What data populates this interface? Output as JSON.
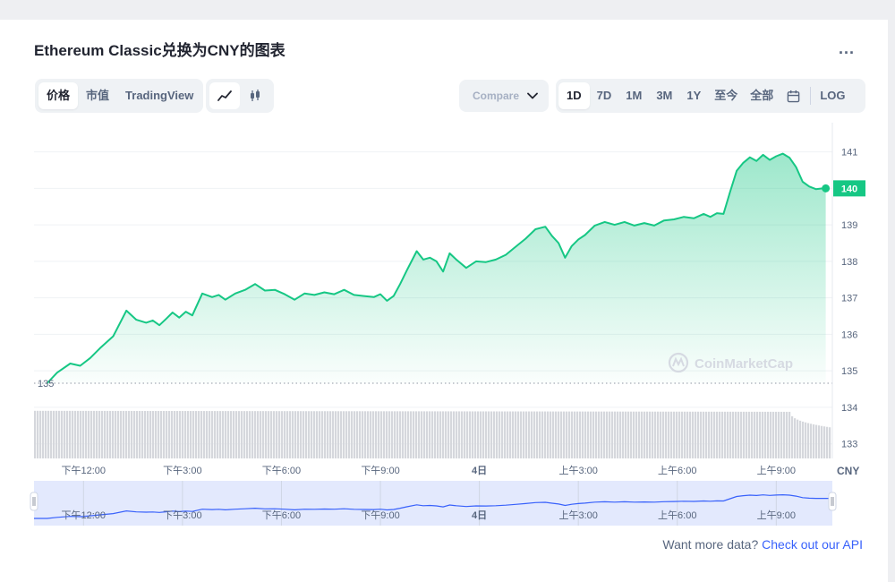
{
  "header": {
    "title": "Ethereum Classic兑换为CNY的图表",
    "more_label": "..."
  },
  "tabs": {
    "items": [
      {
        "label": "价格",
        "active": true
      },
      {
        "label": "市值",
        "active": false
      },
      {
        "label": "TradingView",
        "active": false
      }
    ]
  },
  "chart_type_toggle": [
    {
      "icon": "line-chart-icon",
      "active": true
    },
    {
      "icon": "candlestick-icon",
      "active": false
    }
  ],
  "compare": {
    "placeholder": "Compare with"
  },
  "ranges": {
    "items": [
      {
        "label": "1D",
        "active": true
      },
      {
        "label": "7D",
        "active": false
      },
      {
        "label": "1M",
        "active": false
      },
      {
        "label": "3M",
        "active": false
      },
      {
        "label": "1Y",
        "active": false
      },
      {
        "label": "至今",
        "active": false
      },
      {
        "label": "全部",
        "active": false
      }
    ],
    "calendar_icon": "calendar-icon",
    "log_label": "LOG"
  },
  "footer": {
    "prompt": "Want more data?",
    "link": "Check out our API"
  },
  "colors": {
    "line": "#16c784",
    "navigator_line": "#3861fb",
    "navigator_fill": "#e3e9fd",
    "volume": "#d5d7dc",
    "grid": "#eff2f5",
    "axis_text": "#58667e",
    "current_price_bg": "#16c784"
  },
  "chart_data": {
    "type": "area",
    "watermark": "CoinMarketCap",
    "currency_label": "CNY",
    "ylim": [
      132.6,
      141.8
    ],
    "yticks": [
      141,
      140,
      139,
      138,
      137,
      136,
      135,
      134,
      133
    ],
    "open_price_label": "135",
    "open_price": 134.66,
    "current_price_label": "140",
    "current_price": 140.0,
    "x_labels": [
      "下午12:00",
      "下午3:00",
      "下午6:00",
      "下午9:00",
      "4日",
      "上午3:00",
      "上午6:00",
      "上午9:00"
    ],
    "x_label_hours": [
      12,
      15,
      18,
      21,
      24,
      27,
      30,
      33
    ],
    "x_start_hour": 10.5,
    "x_end_hour": 34.7,
    "series": [
      {
        "hours": [
          10.9,
          11.2,
          11.6,
          11.9,
          12.2,
          12.5,
          12.9,
          13.3,
          13.6,
          13.9,
          14.1,
          14.3,
          14.5,
          14.7,
          14.9,
          15.1,
          15.3,
          15.6,
          15.9,
          16.1,
          16.3,
          16.6,
          16.9,
          17.2,
          17.5,
          17.8,
          18.1,
          18.4,
          18.7,
          19.0,
          19.3,
          19.6,
          19.9,
          20.2,
          20.5,
          20.8,
          21.0,
          21.2,
          21.4,
          21.6,
          21.8,
          22.1,
          22.3,
          22.5,
          22.7,
          22.9,
          23.1,
          23.3,
          23.6,
          23.9,
          24.2,
          24.5,
          24.8,
          25.1,
          25.4,
          25.7,
          26.0,
          26.2,
          26.4,
          26.6,
          26.8,
          27.0,
          27.2,
          27.5,
          27.8,
          28.1,
          28.4,
          28.7,
          29.0,
          29.3,
          29.6,
          29.9,
          30.2,
          30.5,
          30.8,
          31.0,
          31.2,
          31.4,
          31.6,
          31.8,
          32.0,
          32.2,
          32.4,
          32.6,
          32.8,
          33.0,
          33.2,
          33.4,
          33.6,
          33.8,
          34.0,
          34.2,
          34.4,
          34.5
        ],
        "values": [
          134.66,
          134.95,
          135.2,
          135.14,
          135.35,
          135.62,
          135.95,
          136.65,
          136.4,
          136.32,
          136.38,
          136.25,
          136.42,
          136.6,
          136.46,
          136.62,
          136.52,
          137.12,
          137.02,
          137.08,
          136.95,
          137.12,
          137.22,
          137.38,
          137.2,
          137.22,
          137.1,
          136.95,
          137.12,
          137.08,
          137.15,
          137.1,
          137.22,
          137.08,
          137.05,
          137.02,
          137.1,
          136.92,
          137.05,
          137.38,
          137.75,
          138.28,
          138.05,
          138.1,
          138.0,
          137.72,
          138.22,
          138.05,
          137.82,
          138.0,
          137.98,
          138.05,
          138.18,
          138.4,
          138.62,
          138.88,
          138.95,
          138.7,
          138.5,
          138.1,
          138.42,
          138.6,
          138.72,
          138.98,
          139.08,
          139.0,
          139.08,
          138.98,
          139.05,
          138.98,
          139.12,
          139.15,
          139.22,
          139.18,
          139.3,
          139.22,
          139.32,
          139.3,
          139.9,
          140.48,
          140.7,
          140.85,
          140.75,
          140.92,
          140.78,
          140.88,
          140.95,
          140.84,
          140.58,
          140.18,
          140.05,
          139.98,
          140.0,
          140.0
        ]
      }
    ],
    "volume": {
      "hours": [
        10.5,
        33.4,
        34.6
      ],
      "levels": [
        0.95,
        0.93,
        0.62
      ]
    },
    "navigator": {
      "x_labels": [
        "下午12:00",
        "下午3:00",
        "下午6:00",
        "下午9:00",
        "4日",
        "上午3:00",
        "上午6:00",
        "上午9:00"
      ]
    },
    "grid": true
  }
}
